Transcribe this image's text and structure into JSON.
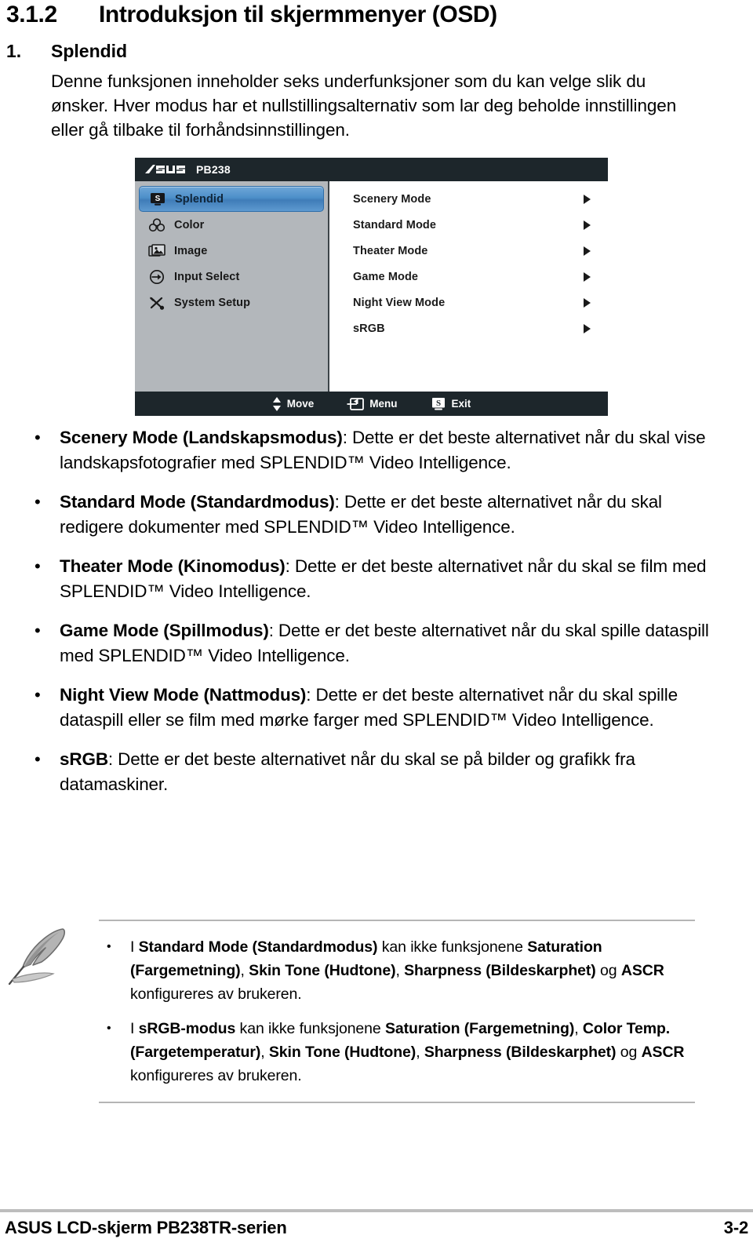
{
  "heading": {
    "number": "3.1.2",
    "title": "Introduksjon til skjermmenyer (OSD)"
  },
  "numbered_item": {
    "number": "1.",
    "title": "Splendid"
  },
  "intro_paragraph": "Denne funksjonen inneholder seks underfunksjoner som du kan velge slik du ønsker. Hver modus har et nullstillingsalternativ som lar deg beholde innstillingen eller gå tilbake til forhåndsinnstillingen.",
  "osd": {
    "brand": "ASUS",
    "model": "PB238",
    "sidebar": [
      {
        "label": "Splendid",
        "icon": "splendid-icon",
        "selected": true
      },
      {
        "label": "Color",
        "icon": "color-icon",
        "selected": false
      },
      {
        "label": "Image",
        "icon": "image-icon",
        "selected": false
      },
      {
        "label": "Input Select",
        "icon": "input-select-icon",
        "selected": false
      },
      {
        "label": "System Setup",
        "icon": "system-setup-icon",
        "selected": false
      }
    ],
    "options": [
      {
        "label": "Scenery Mode"
      },
      {
        "label": "Standard Mode"
      },
      {
        "label": "Theater Mode"
      },
      {
        "label": "Game Mode"
      },
      {
        "label": "Night View Mode"
      },
      {
        "label": "sRGB"
      }
    ],
    "footer": [
      {
        "label": "Move",
        "icon": "up-down-arrows-icon"
      },
      {
        "label": "Menu",
        "icon": "enter-menu-icon"
      },
      {
        "label": "Exit",
        "icon": "s-button-icon"
      }
    ],
    "colors": {
      "chrome": "#1d262b",
      "sidebar": "#b3b7bb",
      "panel": "#ffffff",
      "highlight": "#4d8fc9"
    }
  },
  "bullets": [
    {
      "marker": "•",
      "bold": "Scenery Mode (Landskapsmodus)",
      "rest": ": Dette er det beste alternativet når du skal vise landskapsfotografier med SPLENDID™ Video Intelligence."
    },
    {
      "marker": "•",
      "bold": "Standard Mode (Standardmodus)",
      "rest": ": Dette er det beste alternativet når du skal redigere dokumenter med SPLENDID™ Video Intelligence."
    },
    {
      "marker": "•",
      "bold": "Theater Mode (Kinomodus)",
      "rest": ": Dette er det beste alternativet når du skal se film med SPLENDID™ Video Intelligence."
    },
    {
      "marker": "•",
      "bold": "Game Mode (Spillmodus)",
      "rest": ": Dette er det beste alternativet når du skal spille dataspill med SPLENDID™ Video Intelligence."
    },
    {
      "marker": "•",
      "bold": "Night View Mode (Nattmodus)",
      "rest": ": Dette er det beste alternativet når du skal spille dataspill eller se film med mørke farger med SPLENDID™ Video Intelligence."
    },
    {
      "marker": "•",
      "bold": "sRGB",
      "rest": ": Dette er det beste alternativet når du skal se på bilder og grafikk fra datamaskiner."
    }
  ],
  "note": {
    "icon": "quill-pen-icon",
    "items": [
      {
        "marker": "•",
        "html_parts": [
          {
            "t": "I ",
            "b": false
          },
          {
            "t": "Standard Mode (Standardmodus)",
            "b": true
          },
          {
            "t": " kan ikke funksjonene ",
            "b": false
          },
          {
            "t": "Saturation (Fargemetning)",
            "b": true
          },
          {
            "t": ", ",
            "b": false
          },
          {
            "t": "Skin Tone (Hudtone)",
            "b": true
          },
          {
            "t": ", ",
            "b": false
          },
          {
            "t": "Sharpness (Bildeskarphet)",
            "b": true
          },
          {
            "t": " og ",
            "b": false
          },
          {
            "t": "ASCR",
            "b": true
          },
          {
            "t": " konfigureres av brukeren.",
            "b": false
          }
        ]
      },
      {
        "marker": "•",
        "html_parts": [
          {
            "t": "I ",
            "b": false
          },
          {
            "t": "sRGB-modus",
            "b": true
          },
          {
            "t": " kan ikke funksjonene ",
            "b": false
          },
          {
            "t": "Saturation (Fargemetning)",
            "b": true
          },
          {
            "t": ", ",
            "b": false
          },
          {
            "t": "Color Temp. (Fargetemperatur)",
            "b": true
          },
          {
            "t": ", ",
            "b": false
          },
          {
            "t": "Skin Tone (Hudtone)",
            "b": true
          },
          {
            "t": ", ",
            "b": false
          },
          {
            "t": "Sharpness (Bildeskarphet)",
            "b": true
          },
          {
            "t": " og ",
            "b": false
          },
          {
            "t": "ASCR",
            "b": true
          },
          {
            "t": " konfigureres av brukeren.",
            "b": false
          }
        ]
      }
    ]
  },
  "page_footer": {
    "left": "ASUS LCD-skjerm PB238TR-serien",
    "right": "3-2"
  }
}
